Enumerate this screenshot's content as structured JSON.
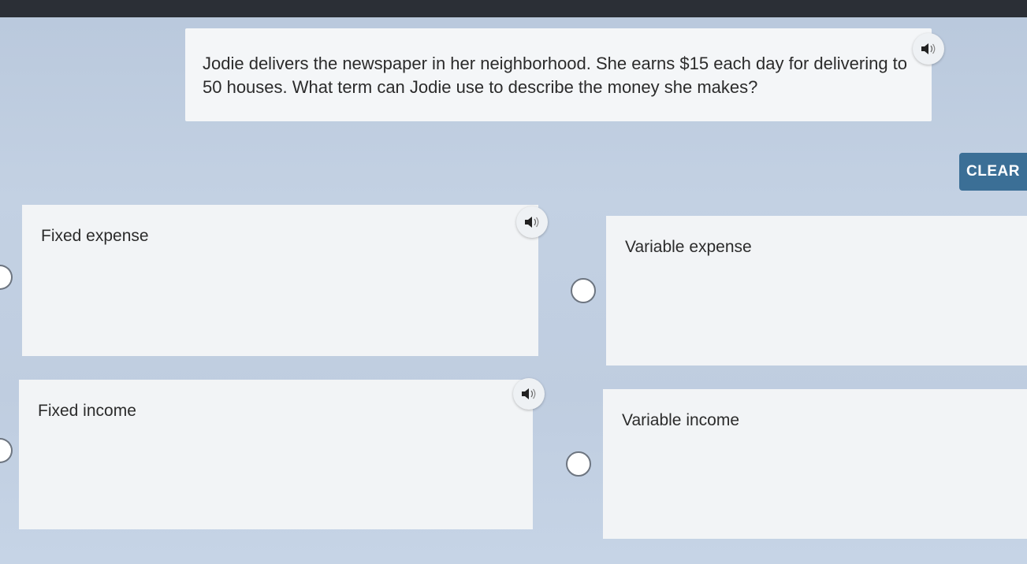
{
  "question": {
    "text": "Jodie delivers the newspaper in her neighborhood. She earns $15 each day for delivering to 50 houses. What term can Jodie use to describe the money she makes?",
    "audio_icon": "speaker-icon"
  },
  "toolbar": {
    "clear_label": "CLEAR"
  },
  "options": [
    {
      "label": "Fixed expense",
      "selected": false,
      "audio_icon": "speaker-icon"
    },
    {
      "label": "Variable expense",
      "selected": false
    },
    {
      "label": "Fixed income",
      "selected": false,
      "audio_icon": "speaker-icon"
    },
    {
      "label": "Variable income",
      "selected": false
    }
  ],
  "colors": {
    "accent": "#3b6f96",
    "card": "#f2f4f6",
    "background": "#c3d1e3"
  }
}
